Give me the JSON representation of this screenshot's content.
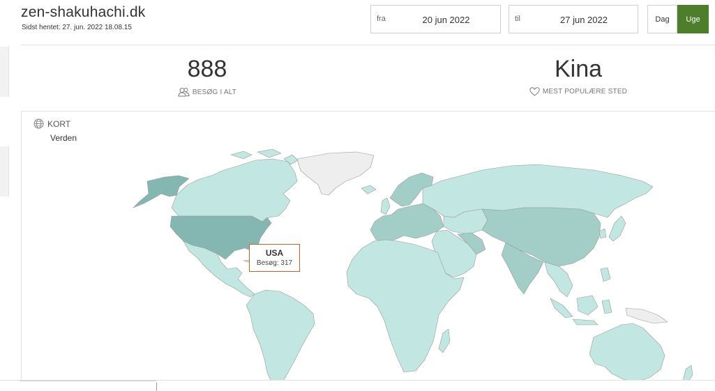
{
  "header": {
    "site_title": "zen-shakuhachi.dk",
    "last_fetched": "Sidst hentet: 27. jun. 2022 18.08.15"
  },
  "date_range": {
    "from_label": "fra",
    "from_value": "20 jun 2022",
    "to_label": "til",
    "to_value": "27 jun 2022"
  },
  "period_toggle": {
    "day_label": "Dag",
    "week_label": "Uge",
    "selected": "Uge"
  },
  "stats": {
    "total_visits_value": "888",
    "total_visits_label": "BESØG I ALT",
    "total_visits_icon": "users-icon",
    "popular_place_value": "Kina",
    "popular_place_label": "MEST POPULÆRE STED",
    "popular_place_icon": "heart-icon"
  },
  "map": {
    "card_title": "KORT",
    "card_icon": "globe-icon",
    "region": "Verden",
    "colors": {
      "low": "#c2e6e1",
      "mid": "#a3cdc7",
      "high": "#84b7b1",
      "no_data": "#eeeeee",
      "border": "#9a9a9a"
    },
    "tooltip": {
      "country": "USA",
      "visits": "Besøg: 317"
    }
  },
  "accent_color": "#4e7d2b",
  "tooltip_border_color": "#c0632a"
}
